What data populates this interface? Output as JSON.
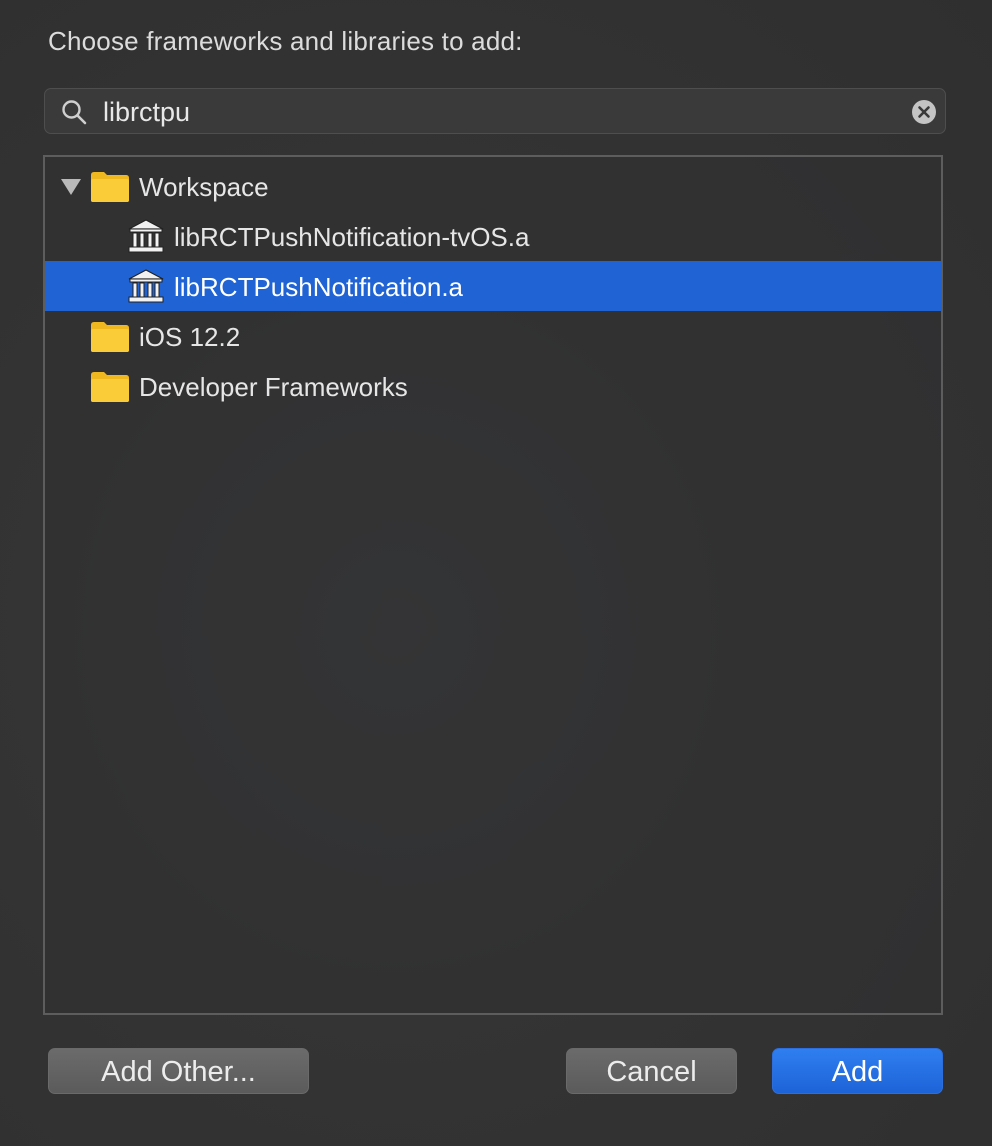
{
  "dialog": {
    "prompt": "Choose frameworks and libraries to add:"
  },
  "search": {
    "value": "librctpu",
    "placeholder": "Search",
    "search_icon": "magnifier-icon",
    "clear_icon": "clear-circle-icon"
  },
  "tree": {
    "workspace": {
      "label": "Workspace",
      "icon": "folder-icon",
      "expanded": true
    },
    "libs": [
      {
        "label": "libRCTPushNotification-tvOS.a",
        "icon": "library-icon",
        "selected": false
      },
      {
        "label": "libRCTPushNotification.a",
        "icon": "library-icon",
        "selected": true
      }
    ],
    "ios": {
      "label": "iOS 12.2",
      "icon": "folder-icon"
    },
    "dev": {
      "label": "Developer Frameworks",
      "icon": "folder-icon"
    }
  },
  "buttons": {
    "add_other": "Add Other...",
    "cancel": "Cancel",
    "add": "Add"
  },
  "colors": {
    "selection": "#1f63d4",
    "folder": "#f7c631",
    "primary_button": "#1d63d8"
  }
}
